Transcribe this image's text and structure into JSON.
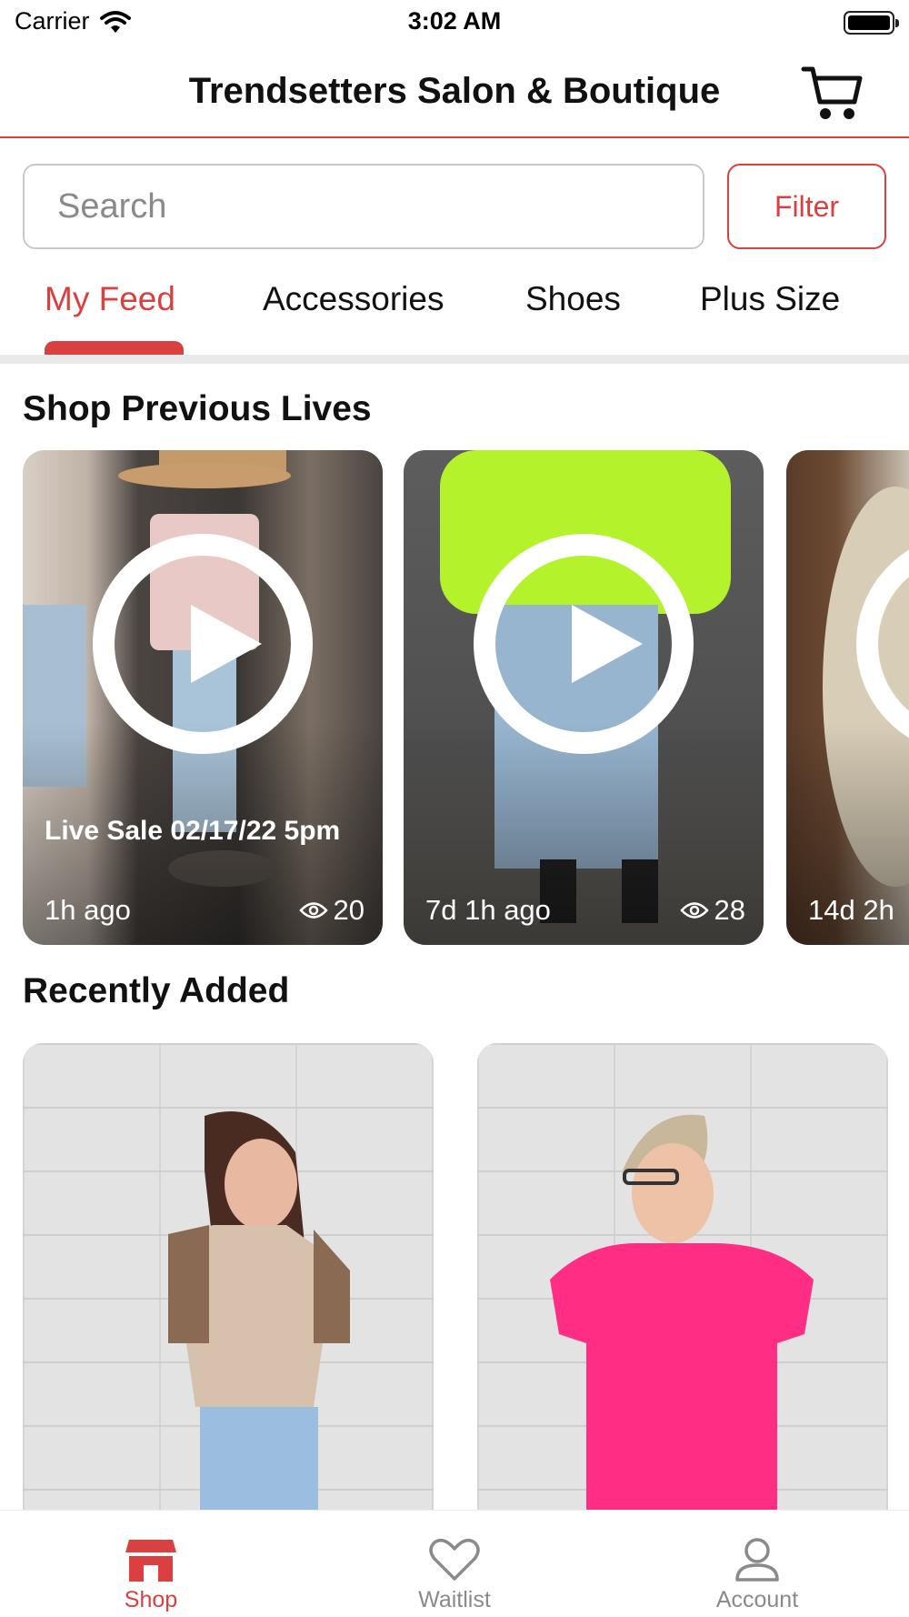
{
  "status_bar": {
    "carrier": "Carrier",
    "time": "3:02 AM"
  },
  "header": {
    "title": "Trendsetters Salon & Boutique",
    "cart_icon": "cart-icon"
  },
  "search": {
    "placeholder": "Search",
    "filter_label": "Filter"
  },
  "tabs": [
    {
      "label": "My Feed",
      "active": true
    },
    {
      "label": "Accessories",
      "active": false
    },
    {
      "label": "Shoes",
      "active": false
    },
    {
      "label": "Plus Size",
      "active": false
    }
  ],
  "previous_lives": {
    "title": "Shop Previous Lives",
    "items": [
      {
        "title": "Live Sale 02/17/22 5pm",
        "time_ago": "1h ago",
        "views": "20"
      },
      {
        "title": "",
        "time_ago": "7d 1h ago",
        "views": "28"
      },
      {
        "title": "",
        "time_ago": "14d 2h",
        "views": ""
      }
    ]
  },
  "recently_added": {
    "title": "Recently Added"
  },
  "bottom_nav": [
    {
      "label": "Shop",
      "icon": "store-icon",
      "active": true
    },
    {
      "label": "Waitlist",
      "icon": "heart-icon",
      "active": false
    },
    {
      "label": "Account",
      "icon": "person-icon",
      "active": false
    }
  ],
  "colors": {
    "accent": "#d9403f",
    "inactive": "#8a8a8a"
  }
}
